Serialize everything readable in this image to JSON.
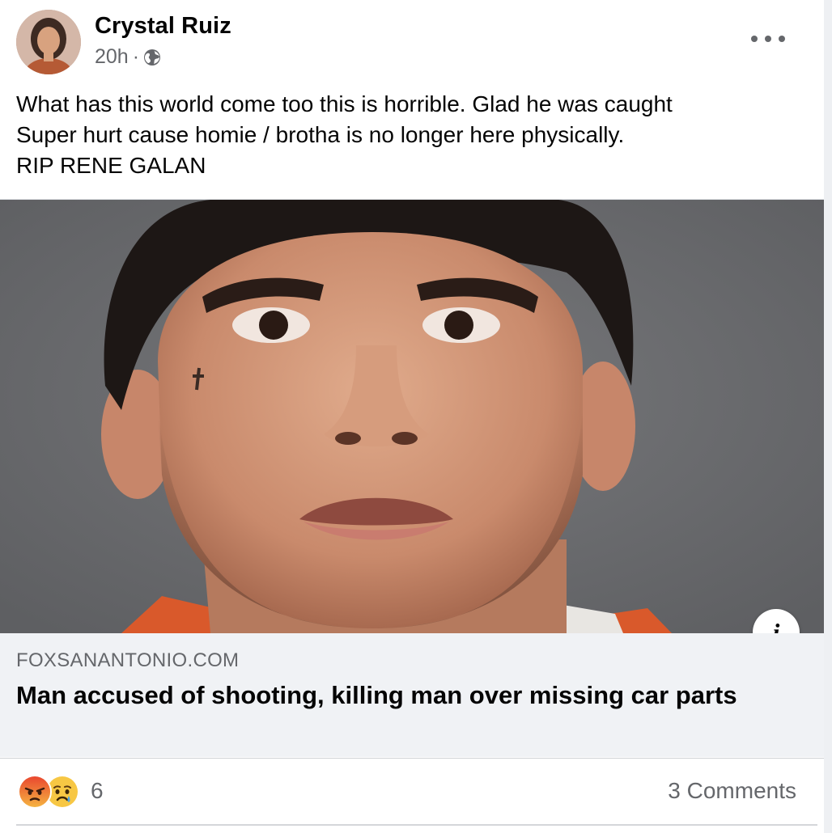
{
  "post": {
    "author": "Crystal Ruiz",
    "time": "20h",
    "separator": "·",
    "privacy_icon": "globe-icon",
    "more_icon": "more-options-icon",
    "text_lines": [
      "What has this world come too this is horrible. Glad he was caught",
      "Super hurt cause homie / brotha is no longer here physically.",
      "RIP RENE GALAN"
    ]
  },
  "link_preview": {
    "domain": "FOXSANANTONIO.COM",
    "headline": "Man accused of shooting, killing man over missing car parts",
    "info_icon": "i"
  },
  "reactions": {
    "icons": [
      "angry-reaction-icon",
      "sad-reaction-icon"
    ],
    "count": "6",
    "comments": "3 Comments"
  },
  "colors": {
    "secondary_text": "#65676b",
    "card_background": "#f0f2f5",
    "angry": "#f0712c",
    "sad": "#f7c744"
  }
}
